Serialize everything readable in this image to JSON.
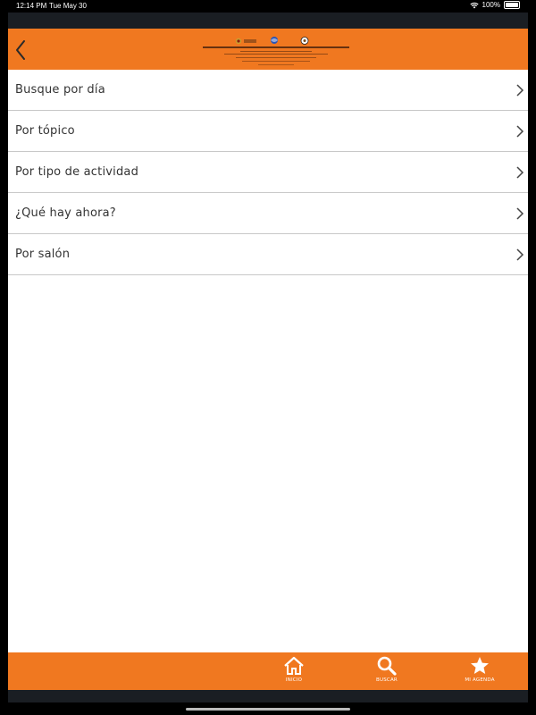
{
  "status": {
    "time": "12:14 PM",
    "date": "Tue May 30",
    "battery": "100%"
  },
  "header": {
    "back_icon": "chevron-left-icon",
    "logo_text": "CONGRESO INTERNACIONAL ASOCIACIÓN PANAMERICANA DE OÍDO Y CIRUGÍA DE CABEZA Y CUELLO"
  },
  "menu": {
    "items": [
      {
        "label": "Busque por día"
      },
      {
        "label": "Por tópico"
      },
      {
        "label": "Por tipo de actividad"
      },
      {
        "label": "¿Qué hay ahora?"
      },
      {
        "label": "Por salón"
      }
    ]
  },
  "tabs": [
    {
      "label": "INICIO",
      "icon": "home-icon"
    },
    {
      "label": "BUSCAR",
      "icon": "search-icon"
    },
    {
      "label": "MI AGENDA",
      "icon": "star-icon"
    }
  ],
  "colors": {
    "accent": "#f07820",
    "dark": "#1a1e23"
  }
}
